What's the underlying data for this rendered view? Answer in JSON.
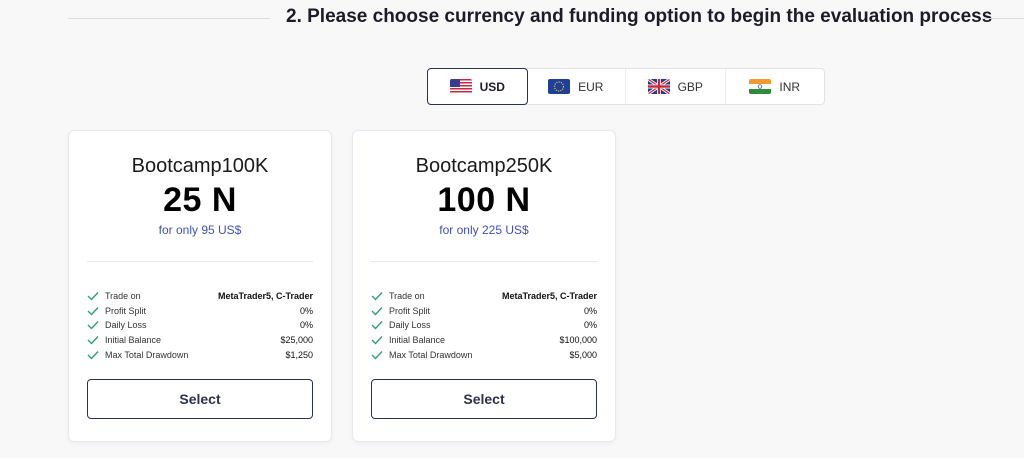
{
  "step": {
    "title": "2. Please choose currency and funding option to begin the evaluation process"
  },
  "currencies": [
    {
      "code": "USD",
      "flag": "us-flag-icon",
      "active": true
    },
    {
      "code": "EUR",
      "flag": "eu-flag-icon",
      "active": false
    },
    {
      "code": "GBP",
      "flag": "uk-flag-icon",
      "active": false
    },
    {
      "code": "INR",
      "flag": "india-flag-icon",
      "active": false
    }
  ],
  "colors": {
    "accent": "#2c3150",
    "price": "#3f51b5",
    "check": "#2e9e7a"
  },
  "plans": [
    {
      "name": "Bootcamp100K",
      "amount": "25 N",
      "price": "for only 95 US$",
      "features": [
        {
          "label": "Trade on",
          "value": "MetaTrader5, C-Trader"
        },
        {
          "label": "Profit Split",
          "value": "0%"
        },
        {
          "label": "Daily Loss",
          "value": "0%"
        },
        {
          "label": "Initial Balance",
          "value": "$25,000"
        },
        {
          "label": "Max Total Drawdown",
          "value": "$1,250"
        }
      ],
      "button": "Select"
    },
    {
      "name": "Bootcamp250K",
      "amount": "100 N",
      "price": "for only 225 US$",
      "features": [
        {
          "label": "Trade on",
          "value": "MetaTrader5, C-Trader"
        },
        {
          "label": "Profit Split",
          "value": "0%"
        },
        {
          "label": "Daily Loss",
          "value": "0%"
        },
        {
          "label": "Initial Balance",
          "value": "$100,000"
        },
        {
          "label": "Max Total Drawdown",
          "value": "$5,000"
        }
      ],
      "button": "Select"
    }
  ]
}
